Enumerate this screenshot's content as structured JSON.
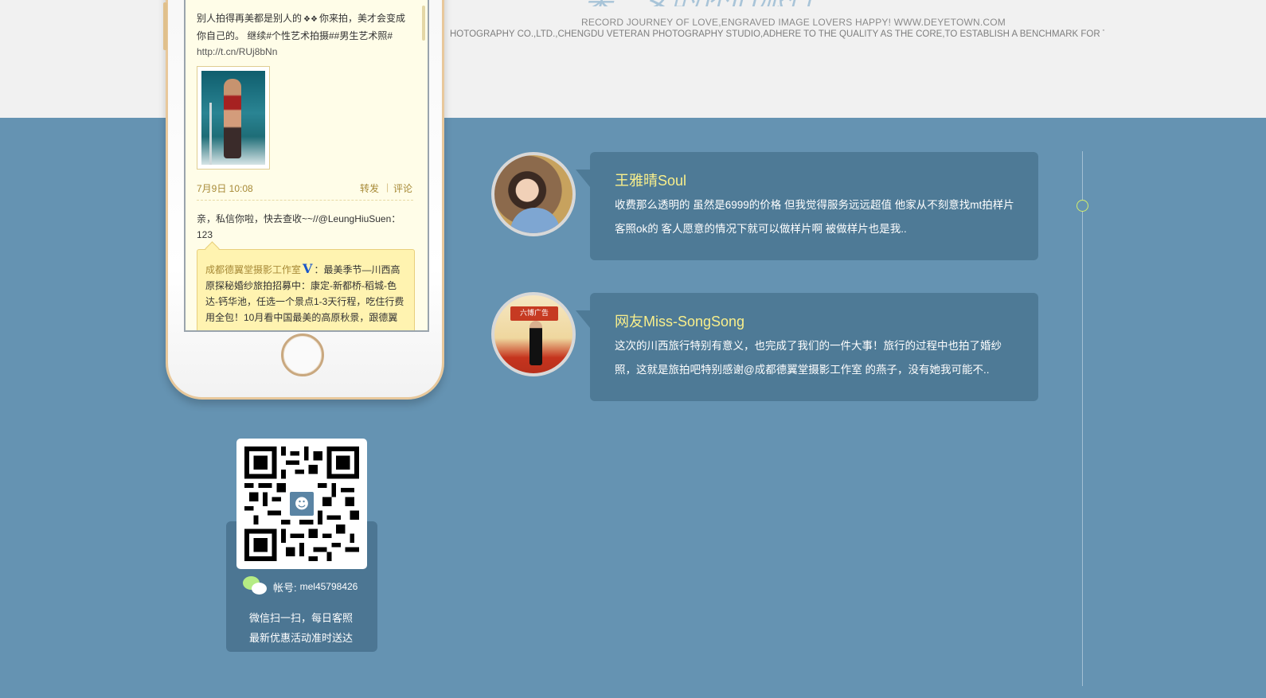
{
  "header": {
    "title_fragment": "梁三女的怀旧旅行",
    "tagline": "RECORD JOURNEY OF LOVE,ENGRAVED IMAGE LOVERS HAPPY!   WWW.DEYETOWN.COM",
    "company_line": "HOTOGRAPHY CO.,LTD.,CHENGDU VETERAN PHOTOGRAPHY STUDIO,ADHERE TO THE QUALITY AS THE CORE,TO ESTABLISH A BENCHMARK FOR TH"
  },
  "phone_feed": {
    "post": {
      "text_before_icon": "别人拍得再美都是别人的",
      "text_after_icon": "你来拍，美才会变成你自己的。 继续#个性艺术拍摄##男生艺术照# ",
      "link": "http://t.cn/RUj8bNn",
      "time": "7月9日 10:08",
      "repost_label": "转发",
      "separator": "|",
      "comment_label": "评论"
    },
    "reply": {
      "text": "亲，私信你啦，快去查收~~//@LeungHiuSuen：123"
    },
    "quoted": {
      "author": "成都德翼堂摄影工作室",
      "badge": "V",
      "text": "：最美季节—川西高原探秘婚纱旅拍招募中：康定-新都桥-稻城-色达-钙华池，任选一个景点1-3天行程，吃住行费用全包！10月看中国最美的高原秋景，跟德翼"
    }
  },
  "wechat": {
    "account_label": "帐号:",
    "account_value": "mel45798426",
    "note_line1": "微信扫一扫，每日客照",
    "note_line2": "最新优惠活动准时送达"
  },
  "reviews": [
    {
      "name": "王雅晴Soul",
      "text": "收费那么透明的 虽然是6999的价格 但我觉得服务远远超值 他家从不刻意找mt拍样片 客照ok的 客人愿意的情况下就可以做样片啊 被做样片也是我.."
    },
    {
      "name": "网友Miss-SongSong",
      "text": "这次的川西旅行特别有意义，也完成了我们的一件大事！旅行的过程中也拍了婚纱照，这就是旅拍吧特别感谢@成都德翼堂摄影工作室 的燕子，没有她我可能不.."
    }
  ],
  "avatar2_banner": "六博广告",
  "colors": {
    "background": "#6593b2",
    "bubble": "#4e7a96",
    "name_accent": "#f9ef8b",
    "timeline_dot": "#d6ef6b"
  }
}
